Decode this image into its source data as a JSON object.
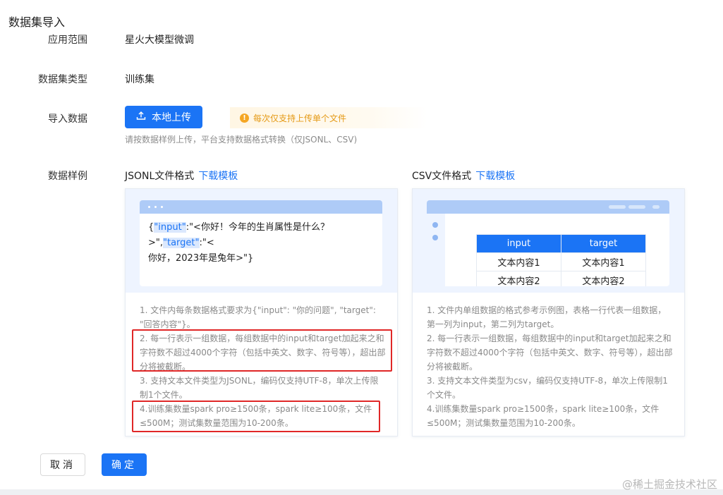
{
  "page": {
    "title": "数据集导入"
  },
  "form": {
    "scope_label": "应用范围",
    "scope_value": "星火大模型微调",
    "type_label": "数据集类型",
    "type_value": "训练集",
    "import_label": "导入数据",
    "upload_button": "本地上传",
    "notice": "每次仅支持上传单个文件",
    "hint": "请按数据样例上传，平台支持数据格式转换（仅JSONL、CSV)",
    "sample_label": "数据样例"
  },
  "jsonl": {
    "title": "JSONL文件格式",
    "download": "下载模板",
    "code": {
      "open": "{",
      "key_input": "\"input\"",
      "mid1": ":\"<你好！今年的生肖属性是什么？>\",",
      "key_target": "\"target\"",
      "mid2": ":\"<",
      "line2": "你好，2023年是兔年>\"}"
    },
    "notes": [
      "1. 文件内每条数据格式要求为{\"input\": \"你的问题\", \"target\": \"回答内容\"}。",
      "2. 每一行表示一组数据，每组数据中的input和target加起来之和字符数不超过4000个字符（包括中英文、数字、符号等），超出部分将被截断。",
      "3. 支持文本文件类型为JSONL，编码仅支持UTF-8，单次上传限制1个文件。",
      "4.训练集数量spark pro≥1500条，spark lite≥100条，文件≤500M；测试集数量范围为10-200条。"
    ]
  },
  "csv": {
    "title": "CSV文件格式",
    "download": "下载模板",
    "table": {
      "headers": [
        "input",
        "target"
      ],
      "rows": [
        [
          "文本内容1",
          "文本内容1"
        ],
        [
          "文本内容2",
          "文本内容2"
        ]
      ]
    },
    "notes": [
      "1. 文件内单组数据的格式参考示例图，表格一行代表一组数据，第一列为input，第二列为target。",
      "2. 每一行表示一组数据，每组数据中的input和target加起来之和字符数不超过4000个字符（包括中英文、数字、符号等），超出部分将被截断。",
      "3. 支持文本文件类型为csv，编码仅支持UTF-8，单次上传限制1个文件。",
      "4.训练集数量spark pro≥1500条，spark lite≥100条，文件≤500M；测试集数量范围为10-200条。"
    ]
  },
  "actions": {
    "cancel": "取消",
    "confirm": "确定"
  },
  "watermark": "@稀土掘金技术社区"
}
